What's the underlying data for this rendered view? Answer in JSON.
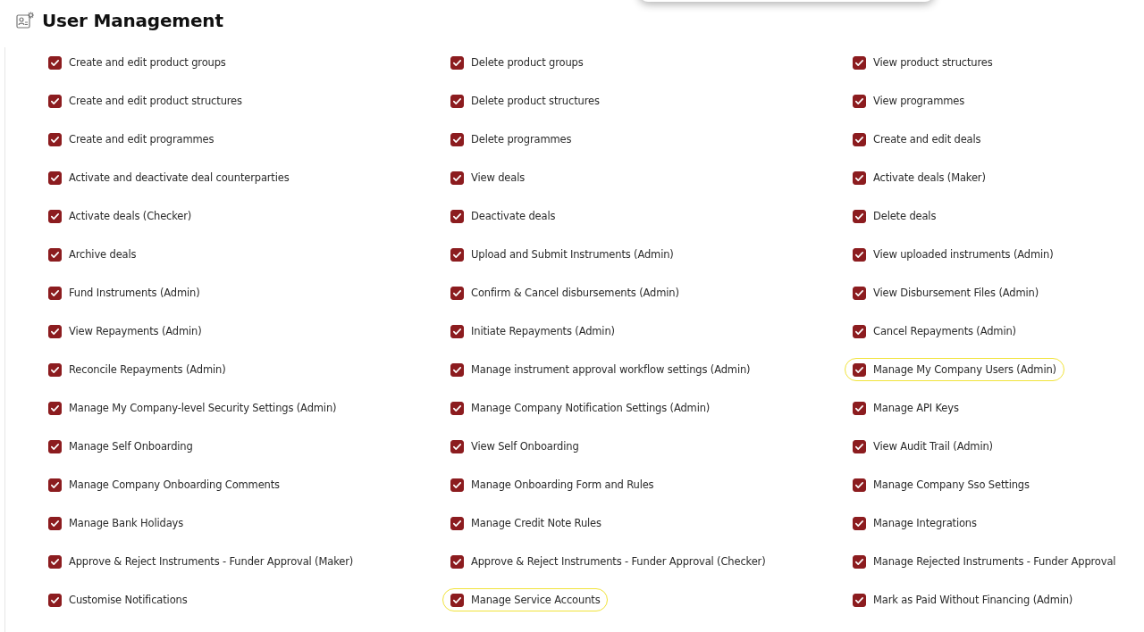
{
  "page": {
    "title": "User Management"
  },
  "permissions": [
    {
      "label": "Create and edit product groups",
      "checked": true,
      "highlighted": false
    },
    {
      "label": "Delete product groups",
      "checked": true,
      "highlighted": false
    },
    {
      "label": "View product structures",
      "checked": true,
      "highlighted": false
    },
    {
      "label": "Create and edit product structures",
      "checked": true,
      "highlighted": false
    },
    {
      "label": "Delete product structures",
      "checked": true,
      "highlighted": false
    },
    {
      "label": "View programmes",
      "checked": true,
      "highlighted": false
    },
    {
      "label": "Create and edit programmes",
      "checked": true,
      "highlighted": false
    },
    {
      "label": "Delete programmes",
      "checked": true,
      "highlighted": false
    },
    {
      "label": "Create and edit deals",
      "checked": true,
      "highlighted": false
    },
    {
      "label": "Activate and deactivate deal counterparties",
      "checked": true,
      "highlighted": false
    },
    {
      "label": "View deals",
      "checked": true,
      "highlighted": false
    },
    {
      "label": "Activate deals (Maker)",
      "checked": true,
      "highlighted": false
    },
    {
      "label": "Activate deals (Checker)",
      "checked": true,
      "highlighted": false
    },
    {
      "label": "Deactivate deals",
      "checked": true,
      "highlighted": false
    },
    {
      "label": "Delete deals",
      "checked": true,
      "highlighted": false
    },
    {
      "label": "Archive deals",
      "checked": true,
      "highlighted": false
    },
    {
      "label": "Upload and Submit Instruments (Admin)",
      "checked": true,
      "highlighted": false
    },
    {
      "label": "View uploaded instruments (Admin)",
      "checked": true,
      "highlighted": false
    },
    {
      "label": "Fund Instruments (Admin)",
      "checked": true,
      "highlighted": false
    },
    {
      "label": "Confirm & Cancel disbursements (Admin)",
      "checked": true,
      "highlighted": false
    },
    {
      "label": "View Disbursement Files (Admin)",
      "checked": true,
      "highlighted": false
    },
    {
      "label": "View Repayments (Admin)",
      "checked": true,
      "highlighted": false
    },
    {
      "label": "Initiate Repayments (Admin)",
      "checked": true,
      "highlighted": false
    },
    {
      "label": "Cancel Repayments (Admin)",
      "checked": true,
      "highlighted": false
    },
    {
      "label": "Reconcile Repayments (Admin)",
      "checked": true,
      "highlighted": false
    },
    {
      "label": "Manage instrument approval workflow settings (Admin)",
      "checked": true,
      "highlighted": false
    },
    {
      "label": "Manage My Company Users (Admin)",
      "checked": true,
      "highlighted": true
    },
    {
      "label": "Manage My Company-level Security Settings (Admin)",
      "checked": true,
      "highlighted": false
    },
    {
      "label": "Manage Company Notification Settings (Admin)",
      "checked": true,
      "highlighted": false
    },
    {
      "label": "Manage API Keys",
      "checked": true,
      "highlighted": false
    },
    {
      "label": "Manage Self Onboarding",
      "checked": true,
      "highlighted": false
    },
    {
      "label": "View Self Onboarding",
      "checked": true,
      "highlighted": false
    },
    {
      "label": "View Audit Trail (Admin)",
      "checked": true,
      "highlighted": false
    },
    {
      "label": "Manage Company Onboarding Comments",
      "checked": true,
      "highlighted": false
    },
    {
      "label": "Manage Onboarding Form and Rules",
      "checked": true,
      "highlighted": false
    },
    {
      "label": "Manage Company Sso Settings",
      "checked": true,
      "highlighted": false
    },
    {
      "label": "Manage Bank Holidays",
      "checked": true,
      "highlighted": false
    },
    {
      "label": "Manage Credit Note Rules",
      "checked": true,
      "highlighted": false
    },
    {
      "label": "Manage Integrations",
      "checked": true,
      "highlighted": false
    },
    {
      "label": "Approve & Reject Instruments - Funder Approval (Maker)",
      "checked": true,
      "highlighted": false
    },
    {
      "label": "Approve & Reject Instruments - Funder Approval (Checker)",
      "checked": true,
      "highlighted": false
    },
    {
      "label": "Manage Rejected Instruments - Funder Approval",
      "checked": true,
      "highlighted": false
    },
    {
      "label": "Customise Notifications",
      "checked": true,
      "highlighted": false
    },
    {
      "label": "Manage Service Accounts",
      "checked": true,
      "highlighted": true
    },
    {
      "label": "Mark as Paid Without Financing (Admin)",
      "checked": true,
      "highlighted": false
    }
  ]
}
